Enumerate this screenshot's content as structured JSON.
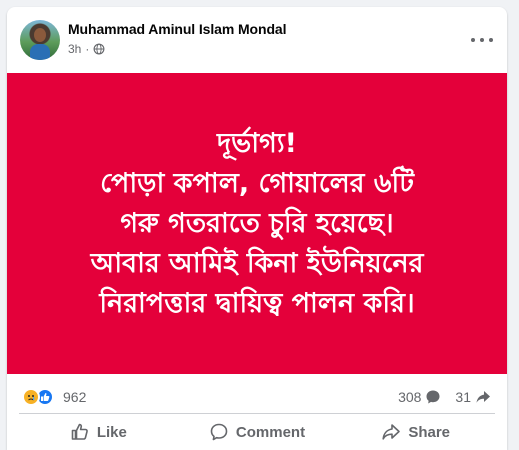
{
  "post": {
    "author": "Muhammad Aminul Islam Mondal",
    "time": "3h",
    "separator": "·",
    "privacy_icon": "globe-icon",
    "more_icon": "more-options-icon",
    "image_bg_color": "#e4003a",
    "image_text_lines": [
      "দূর্ভাগ্য!",
      "পোড়া কপাল, গোয়ালের ৬টি",
      "গরু গতরাতে চুরি হয়েছে।",
      "আবার আমিই কিনা ইউনিয়নের",
      "নিরাপত্তার দ্বায়িত্ব পালন করি।"
    ]
  },
  "stats": {
    "reaction_icons": [
      "sad-icon",
      "like-icon"
    ],
    "reaction_count": "962",
    "comment_count": "308",
    "share_count": "31"
  },
  "actions": {
    "like_label": "Like",
    "comment_label": "Comment",
    "share_label": "Share"
  }
}
